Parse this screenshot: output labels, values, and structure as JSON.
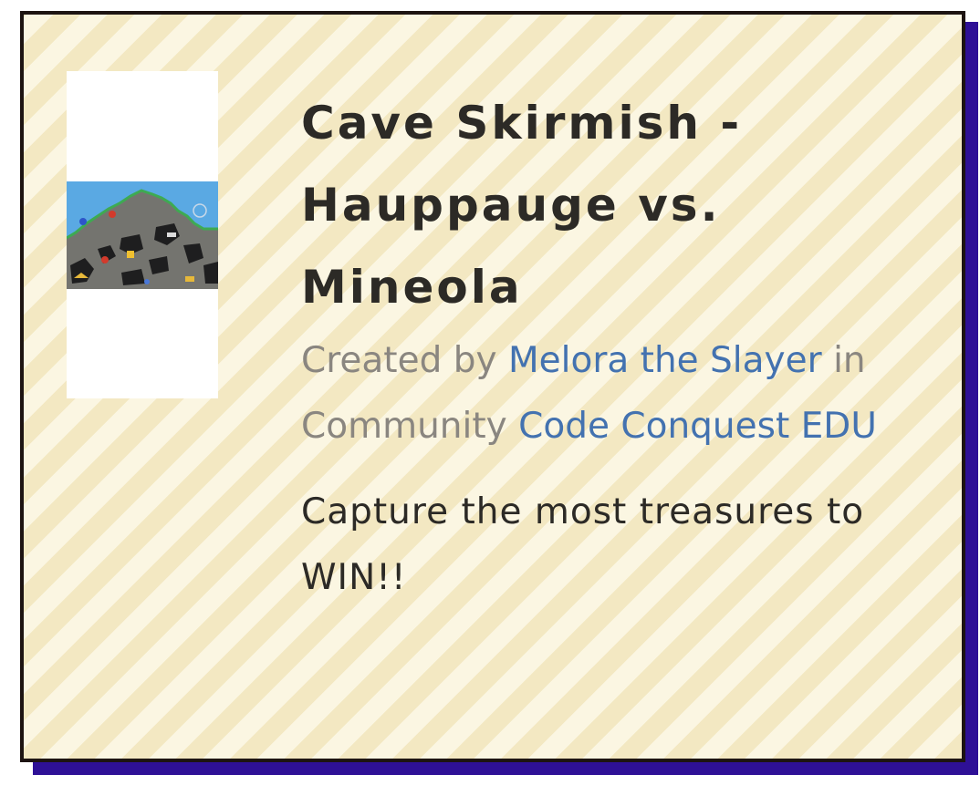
{
  "level": {
    "title": "Cave Skirmish - Hauppauge vs. Mineola",
    "created_by_prefix": "Created by",
    "author": "Melora the Slayer",
    "community_prefix": "in Community",
    "community_name": "Code Conquest EDU",
    "description": "Capture the most treasures to WIN!!"
  },
  "thumbnail": {
    "icon": "cave-map-thumbnail"
  },
  "colors": {
    "shadow": "#2e1096",
    "stripe_dark": "#f3e8c2",
    "stripe_light": "#fbf6e2",
    "link": "#4372b0",
    "title": "#2c2a26",
    "meta": "#8a8680"
  }
}
